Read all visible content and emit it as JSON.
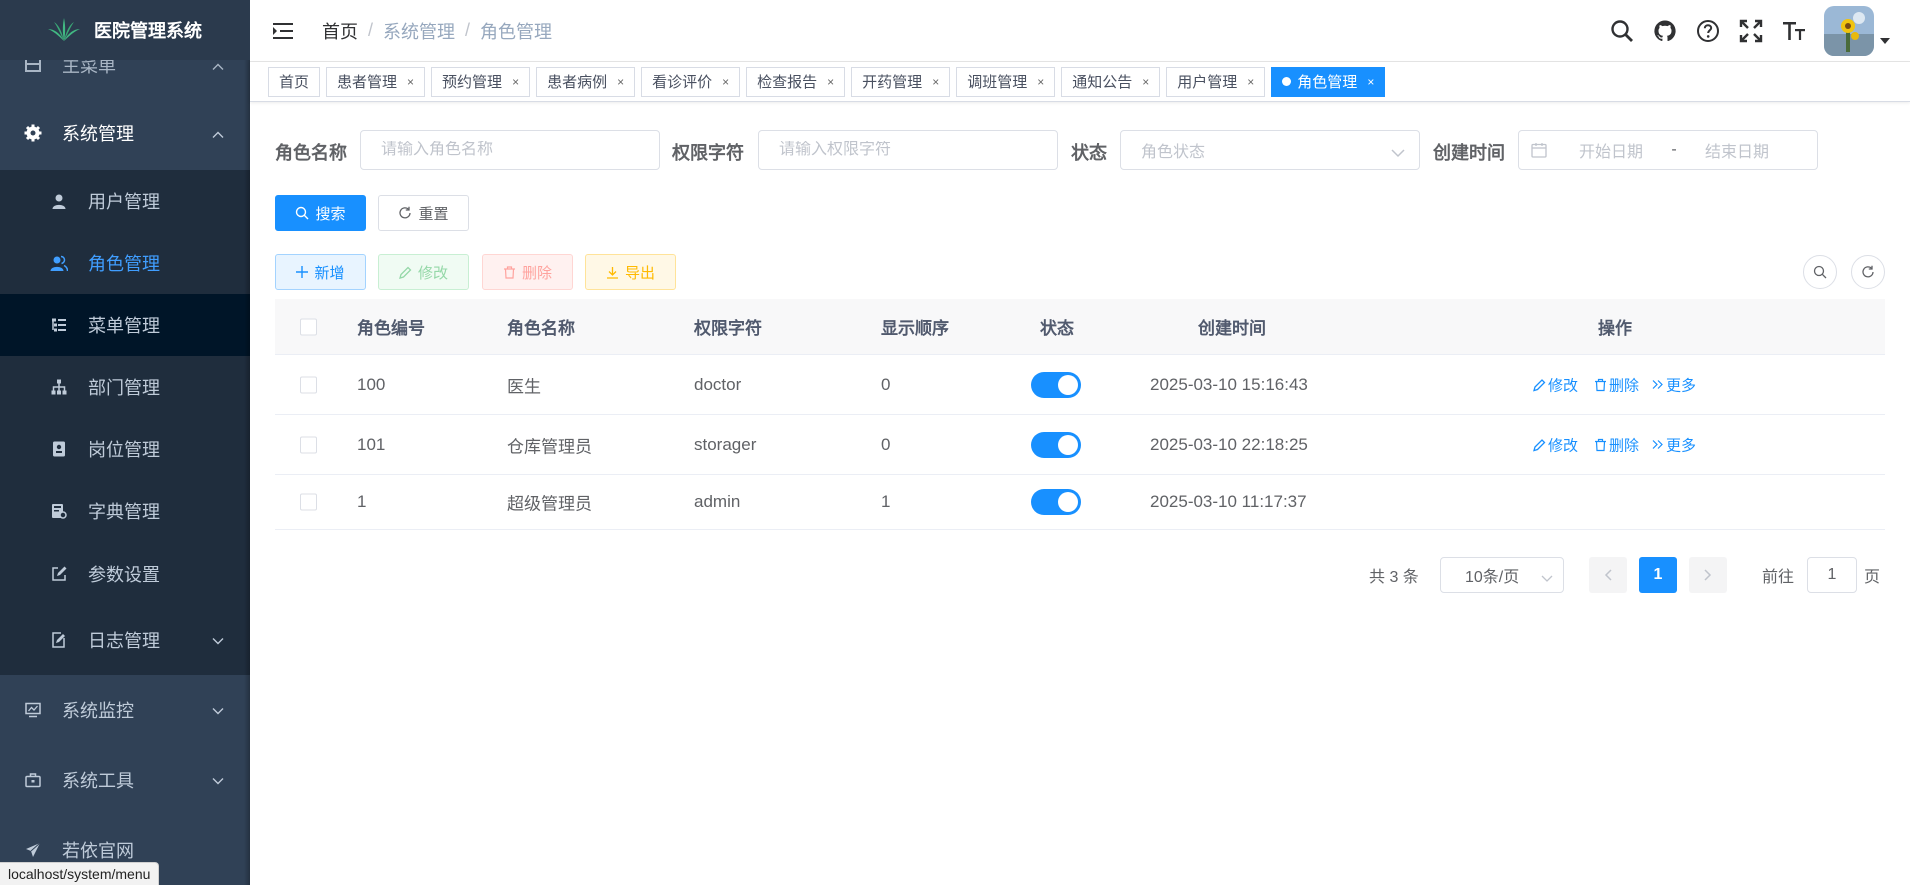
{
  "app": {
    "title": "医院管理系统"
  },
  "sidebar": {
    "partial_item": "主菜单",
    "system_group": "系统管理",
    "items": [
      {
        "label": "用户管理",
        "icon": "user-icon"
      },
      {
        "label": "角色管理",
        "icon": "peoples-icon"
      },
      {
        "label": "菜单管理",
        "icon": "tree-table-icon"
      },
      {
        "label": "部门管理",
        "icon": "tree-icon"
      },
      {
        "label": "岗位管理",
        "icon": "post-icon"
      },
      {
        "label": "字典管理",
        "icon": "dict-icon"
      },
      {
        "label": "参数设置",
        "icon": "edit-icon"
      },
      {
        "label": "日志管理",
        "icon": "log-icon"
      }
    ],
    "monitor_group": "系统监控",
    "tool_group": "系统工具",
    "site_link": "若依官网",
    "status_url": "localhost/system/menu"
  },
  "breadcrumb": {
    "home": "首页",
    "parent": "系统管理",
    "current": "角色管理"
  },
  "tags": [
    {
      "label": "首页",
      "closable": false
    },
    {
      "label": "患者管理",
      "closable": true
    },
    {
      "label": "预约管理",
      "closable": true
    },
    {
      "label": "患者病例",
      "closable": true
    },
    {
      "label": "看诊评价",
      "closable": true
    },
    {
      "label": "检查报告",
      "closable": true
    },
    {
      "label": "开药管理",
      "closable": true
    },
    {
      "label": "调班管理",
      "closable": true
    },
    {
      "label": "通知公告",
      "closable": true
    },
    {
      "label": "用户管理",
      "closable": true
    },
    {
      "label": "角色管理",
      "closable": true,
      "active": true
    }
  ],
  "close_glyph": "×",
  "search": {
    "role_name_label": "角色名称",
    "role_name_placeholder": "请输入角色名称",
    "role_key_label": "权限字符",
    "role_key_placeholder": "请输入权限字符",
    "status_label": "状态",
    "status_placeholder": "角色状态",
    "time_label": "创建时间",
    "start_placeholder": "开始日期",
    "range_sep": "-",
    "end_placeholder": "结束日期",
    "search_btn": "搜索",
    "reset_btn": "重置"
  },
  "toolbar": {
    "add": "新增",
    "edit": "修改",
    "delete": "删除",
    "export": "导出"
  },
  "table": {
    "headers": {
      "id": "角色编号",
      "name": "角色名称",
      "key": "权限字符",
      "sort": "显示顺序",
      "status": "状态",
      "created": "创建时间",
      "ops": "操作"
    },
    "rows": [
      {
        "id": "100",
        "name": "医生",
        "key": "doctor",
        "sort": "0",
        "status_on": true,
        "created": "2025-03-10 15:16:43",
        "has_ops": true
      },
      {
        "id": "101",
        "name": "仓库管理员",
        "key": "storager",
        "sort": "0",
        "status_on": true,
        "created": "2025-03-10 22:18:25",
        "has_ops": true
      },
      {
        "id": "1",
        "name": "超级管理员",
        "key": "admin",
        "sort": "1",
        "status_on": true,
        "created": "2025-03-10 11:17:37",
        "has_ops": false
      }
    ],
    "op_edit": "修改",
    "op_delete": "删除",
    "op_more": "更多"
  },
  "pagination": {
    "total": "共 3 条",
    "page_size": "10条/页",
    "current": "1",
    "goto_prefix": "前往",
    "goto_value": "1",
    "goto_suffix": "页"
  },
  "colors": {
    "primary": "#1890ff",
    "sidebar_bg": "#304156",
    "submenu_bg": "#1f2d3d"
  }
}
